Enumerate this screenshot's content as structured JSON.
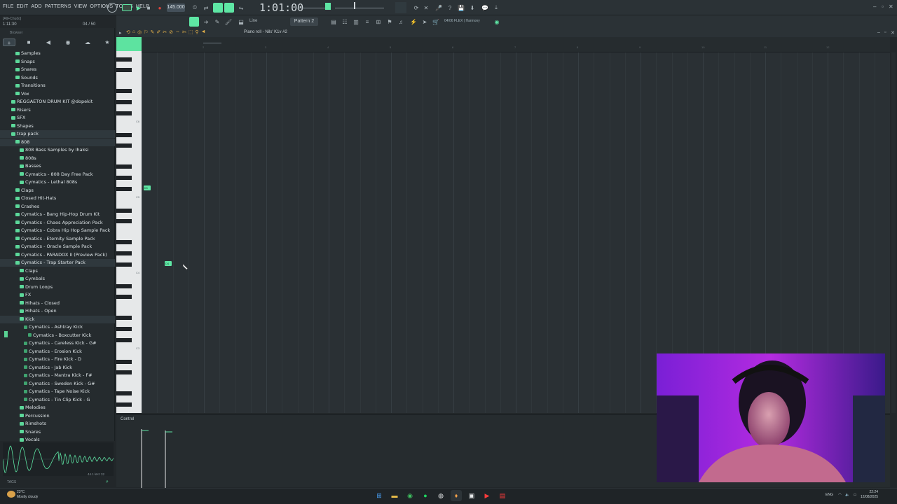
{
  "menu": [
    "FILE",
    "EDIT",
    "ADD",
    "PATTERNS",
    "VIEW",
    "OPTIONS",
    "TOOLS",
    "HELP"
  ],
  "transport": {
    "tempo": "145.000",
    "time": "1:01:00",
    "hint": "[Alt+Chudo]",
    "position": "1:11:30",
    "position_right": "04 / 50"
  },
  "pattern": "Pattern 2",
  "flex": "04/06 FLEX | Harmony",
  "browser": {
    "label": "Browser",
    "tabs": [
      "+",
      "■",
      "◀",
      "◉",
      "☁",
      "★"
    ],
    "items": [
      {
        "label": "Samples",
        "indent": 2,
        "type": "folder"
      },
      {
        "label": "Snaps",
        "indent": 2,
        "type": "folder"
      },
      {
        "label": "Snares",
        "indent": 2,
        "type": "folder"
      },
      {
        "label": "Sounds",
        "indent": 2,
        "type": "folder"
      },
      {
        "label": "Transitions",
        "indent": 2,
        "type": "folder"
      },
      {
        "label": "Vox",
        "indent": 2,
        "type": "folder"
      },
      {
        "label": "REGGAETON DRUM KIT @dopekit",
        "indent": 1,
        "type": "folder"
      },
      {
        "label": "Risers",
        "indent": 1,
        "type": "folder"
      },
      {
        "label": "SFX",
        "indent": 1,
        "type": "folder"
      },
      {
        "label": "Shapes",
        "indent": 1,
        "type": "folder"
      },
      {
        "label": "trap pack",
        "indent": 1,
        "type": "folder",
        "selected": true
      },
      {
        "label": "808",
        "indent": 2,
        "type": "folder",
        "selected": true
      },
      {
        "label": "808 Bass Samples by Ihaksi",
        "indent": 3,
        "type": "folder"
      },
      {
        "label": "808s",
        "indent": 3,
        "type": "folder"
      },
      {
        "label": "Basses",
        "indent": 3,
        "type": "folder"
      },
      {
        "label": "Cymatics - 808 Day Free Pack",
        "indent": 3,
        "type": "folder"
      },
      {
        "label": "Cymatics - Lethal 808s",
        "indent": 3,
        "type": "folder"
      },
      {
        "label": "Claps",
        "indent": 2,
        "type": "folder"
      },
      {
        "label": "Closed Hit-Hats",
        "indent": 2,
        "type": "folder"
      },
      {
        "label": "Crashes",
        "indent": 2,
        "type": "folder"
      },
      {
        "label": "Cymatics - Bang Hip-Hop Drum Kit",
        "indent": 2,
        "type": "folder"
      },
      {
        "label": "Cymatics - Chaos Appreciation Pack",
        "indent": 2,
        "type": "folder"
      },
      {
        "label": "Cymatics - Cobra Hip Hop Sample Pack",
        "indent": 2,
        "type": "folder"
      },
      {
        "label": "Cymatics - Eternity Sample Pack",
        "indent": 2,
        "type": "folder"
      },
      {
        "label": "Cymatics - Oracle Sample Pack",
        "indent": 2,
        "type": "folder"
      },
      {
        "label": "Cymatics - PARADOX II (Preview Pack)",
        "indent": 2,
        "type": "folder"
      },
      {
        "label": "Cymatics - Trap Starter Pack",
        "indent": 2,
        "type": "folder",
        "selected": true
      },
      {
        "label": "Claps",
        "indent": 3,
        "type": "folder"
      },
      {
        "label": "Cymbals",
        "indent": 3,
        "type": "folder"
      },
      {
        "label": "Drum Loops",
        "indent": 3,
        "type": "folder"
      },
      {
        "label": "FX",
        "indent": 3,
        "type": "folder"
      },
      {
        "label": "Hihats - Closed",
        "indent": 3,
        "type": "folder"
      },
      {
        "label": "Hihats - Open",
        "indent": 3,
        "type": "folder"
      },
      {
        "label": "Kick",
        "indent": 3,
        "type": "folder",
        "selected": true
      },
      {
        "label": "Cymatics - Ashtray Kick",
        "indent": 4,
        "type": "file"
      },
      {
        "label": "Cymatics - Boxcutter Kick",
        "indent": 5,
        "type": "file"
      },
      {
        "label": "Cymatics - Careless Kick - G#",
        "indent": 4,
        "type": "file"
      },
      {
        "label": "Cymatics - Erosion Kick",
        "indent": 4,
        "type": "file"
      },
      {
        "label": "Cymatics - Fire Kick - D",
        "indent": 4,
        "type": "file"
      },
      {
        "label": "Cymatics - Jab Kick",
        "indent": 4,
        "type": "file"
      },
      {
        "label": "Cymatics - Mantra Kick - F#",
        "indent": 4,
        "type": "file"
      },
      {
        "label": "Cymatics - Sweden Kick - G#",
        "indent": 4,
        "type": "file"
      },
      {
        "label": "Cymatics - Tape Noise Kick",
        "indent": 4,
        "type": "file"
      },
      {
        "label": "Cymatics - Tin Clip Kick - G",
        "indent": 4,
        "type": "file"
      },
      {
        "label": "Melodies",
        "indent": 3,
        "type": "folder"
      },
      {
        "label": "Percussion",
        "indent": 3,
        "type": "folder"
      },
      {
        "label": "Rimshots",
        "indent": 3,
        "type": "folder"
      },
      {
        "label": "Snares",
        "indent": 3,
        "type": "folder"
      },
      {
        "label": "Vocals",
        "indent": 3,
        "type": "folder"
      }
    ],
    "wave_info": "44.1 kHz 32",
    "tags": "TAGS"
  },
  "piano_roll": {
    "title": "Piano roll - Nils' K1v #2",
    "notes": [
      {
        "label": "D5",
        "beat": 0.3,
        "key": 190
      },
      {
        "label": "D4",
        "beat": 3.7,
        "key": 298
      }
    ],
    "octave_labels": [
      "C6",
      "C5",
      "C4",
      "C3"
    ],
    "bar_numbers": [
      "2",
      "3",
      "4",
      "5",
      "6",
      "7",
      "8",
      "9",
      "10",
      "11",
      "12"
    ]
  },
  "control": {
    "label": "Control"
  },
  "taskbar": {
    "temperature": "23°C",
    "weather": "Mostly cloudy",
    "language": "ENG",
    "time": "22:24",
    "date": "12/08/2025"
  },
  "colors": {
    "accent": "#5ee6a4",
    "background": "#2a3034"
  }
}
